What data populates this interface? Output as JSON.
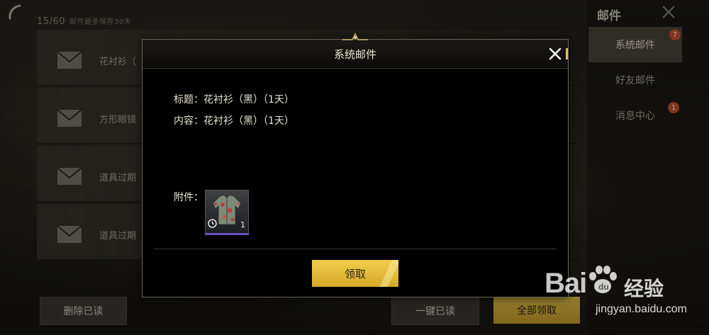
{
  "mailbox": {
    "counter": "15/60",
    "note": "邮件最多保存30天",
    "rows": [
      {
        "title": "花衬衫（"
      },
      {
        "title": "方形眼镜"
      },
      {
        "title": "道具过期"
      },
      {
        "title": "道具过期"
      }
    ],
    "delete_read_label": "删除已读",
    "one_click_read_label": "一键已读",
    "claim_all_label": "全部领取"
  },
  "side": {
    "title": "邮件",
    "tabs": [
      {
        "label": "系统邮件",
        "badge": "7"
      },
      {
        "label": "好友邮件",
        "badge": ""
      },
      {
        "label": "消息中心",
        "badge": "1"
      }
    ]
  },
  "dialog": {
    "title": "系统邮件",
    "subject_line": "标题：花衬衫（黑）（1天）",
    "content_line": "内容：花衬衫（黑）（1天）",
    "attachment_label": "附件：",
    "attachment": {
      "quantity": "1"
    },
    "claim_label": "领取"
  },
  "watermark": {
    "brand": "Bai",
    "brand_cn": "经验",
    "url": "jingyan.baidu.com"
  },
  "colors": {
    "accent_gold": "#e3c149",
    "badge_red": "#c9502c",
    "rarity_purple": "#6c4fc7"
  },
  "icons": [
    "back-icon",
    "envelope-icon",
    "close-icon",
    "clock-icon",
    "shirt-icon",
    "paw-icon"
  ]
}
